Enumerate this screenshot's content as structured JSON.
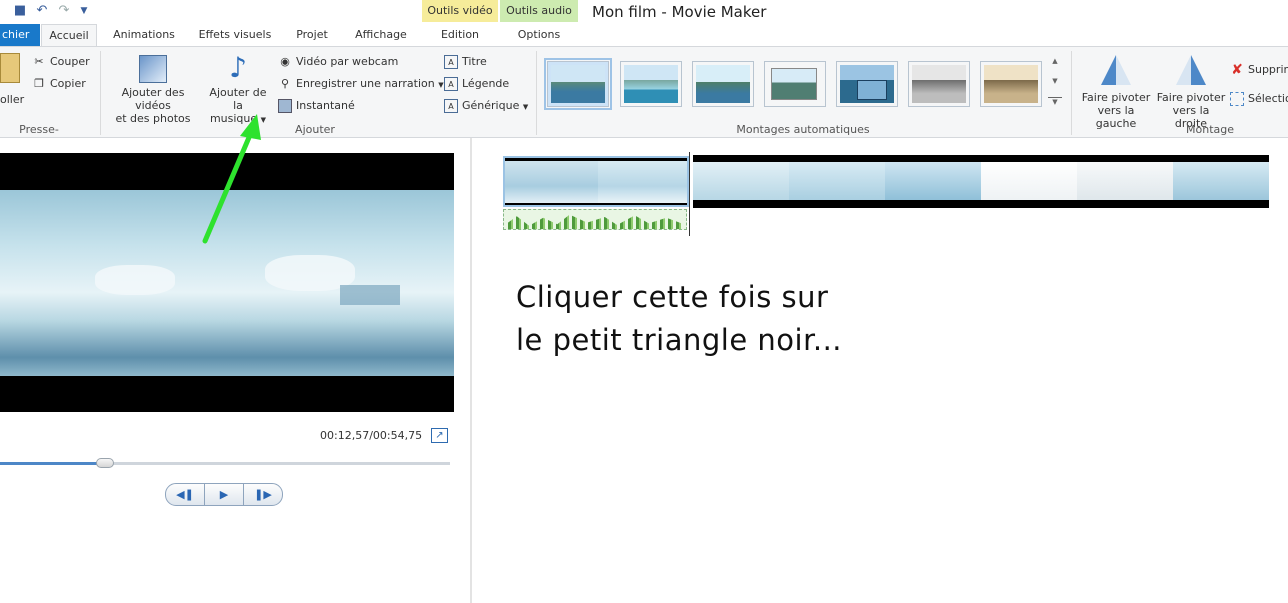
{
  "window": {
    "title": "Mon film - Movie Maker",
    "contextual_groups": [
      {
        "label": "Outils vidéo",
        "color": "#f6ec9a"
      },
      {
        "label": "Outils audio",
        "color": "#cdebb0"
      }
    ]
  },
  "qat": {
    "icons": [
      "save-icon",
      "undo-icon",
      "redo-icon",
      "customize-icon"
    ]
  },
  "tabs": [
    "chier",
    "Accueil",
    "Animations",
    "Effets visuels",
    "Projet",
    "Affichage",
    "Edition",
    "Options"
  ],
  "active_tab": "Accueil",
  "ribbon": {
    "clipboard": {
      "paste_label": "oller",
      "cut_label": "Couper",
      "copy_label": "Copier",
      "group_label": "Presse-papiers"
    },
    "add": {
      "add_videos_label_1": "Ajouter des vidéos",
      "add_videos_label_2": "et des photos",
      "add_music_label_1": "Ajouter de la",
      "add_music_label_2": "musique",
      "webcam_label": "Vidéo par webcam",
      "narration_label": "Enregistrer une narration",
      "snapshot_label": "Instantané",
      "title_label": "Titre",
      "caption_label": "Légende",
      "credits_label": "Générique",
      "group_label": "Ajouter"
    },
    "automovie": {
      "group_label": "Montages automatiques",
      "theme_count": 7
    },
    "editing": {
      "rotate_left_1": "Faire pivoter",
      "rotate_left_2": "vers la gauche",
      "rotate_right_1": "Faire pivoter",
      "rotate_right_2": "vers la droite",
      "remove_label": "Supprim",
      "select_label": "Sélectio",
      "group_label": "Montage"
    }
  },
  "preview": {
    "timecode": "00:12,57/00:54,75",
    "seek_progress": 0.234
  },
  "annotation": {
    "line1": "Cliquer cette fois sur",
    "line2": "le petit triangle noir...",
    "arrow_color": "#2ee22e"
  }
}
